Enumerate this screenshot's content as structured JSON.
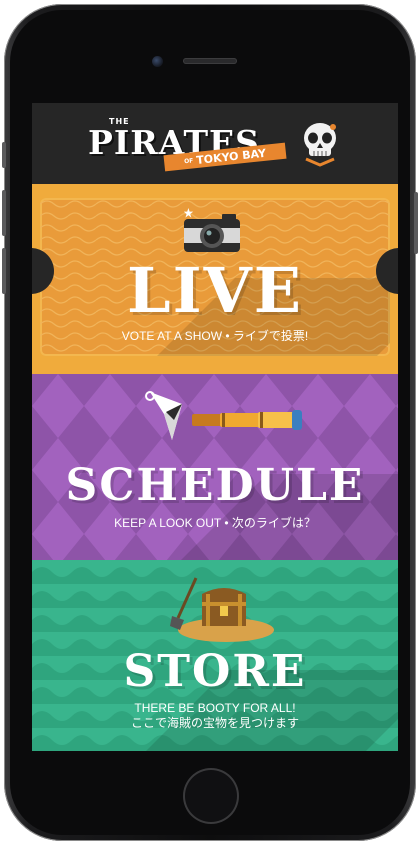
{
  "brand": {
    "the": "THE",
    "pirates": "PIRATES",
    "of": "OF",
    "tokyo_bay": "TOKYO BAY"
  },
  "sections": {
    "live": {
      "title": "LIVE",
      "subtitle": "VOTE AT A SHOW • ライブで投票!"
    },
    "schedule": {
      "title": "SCHEDULE",
      "subtitle": "KEEP A LOOK OUT • 次のライブは？"
    },
    "store": {
      "title": "STORE",
      "subtitle_line1": "THERE BE BOOTY FOR ALL!",
      "subtitle_line2": "ここで海賊の宝物を見つけます"
    }
  },
  "colors": {
    "header": "#262626",
    "live_bg": "#f0ab3c",
    "schedule_bg": "#8e54a8",
    "store_bg": "#39b58d",
    "logo_banner": "#e8862e"
  },
  "icons": [
    "skull-icon",
    "camera-icon",
    "compass-icon",
    "spyglass-icon",
    "treasure-chest-icon",
    "shovel-icon"
  ]
}
